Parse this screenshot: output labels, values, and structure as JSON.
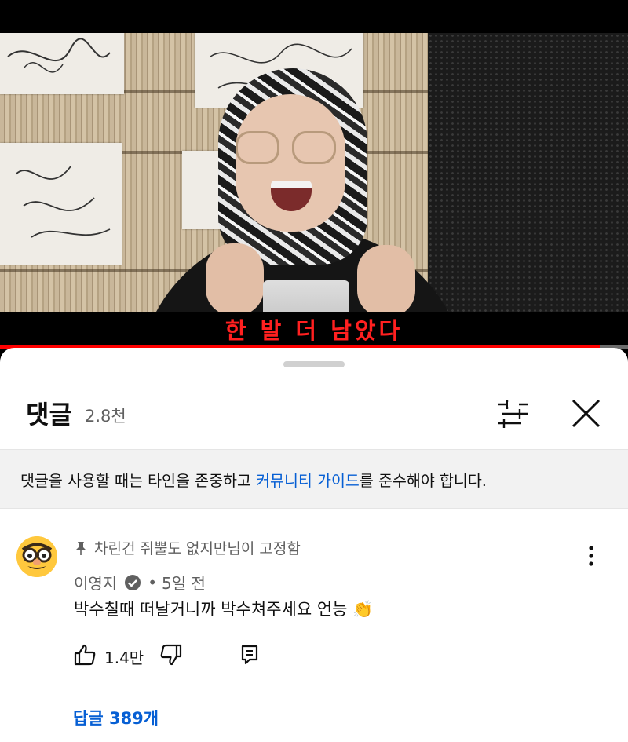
{
  "video": {
    "subtitle": "한 발 더 남았다",
    "progress": 0.955,
    "progress_color": "#ff0000"
  },
  "comments_panel": {
    "title": "댓글",
    "count": "2.8천",
    "filter_icon": "tune-icon",
    "close_icon": "close-icon",
    "guideline_prefix": "댓글을 사용할 때는 타인을 존중하고 ",
    "guideline_link": "커뮤니티 가이드",
    "guideline_suffix": "를 준수해야 합니다.",
    "link_color": "#065fd4"
  },
  "pinned_comment": {
    "pinned_label": "차린건 쥐뿔도 없지만님이 고정함",
    "author": "이영지",
    "time": "5일 전",
    "text": "박수칠때 떠날거니까 박수쳐주세요 언능",
    "emoji": "👏",
    "likes": "1.4만",
    "replies_label": "답글 389개",
    "avatar_icon": "disguise-emoji-avatar"
  }
}
